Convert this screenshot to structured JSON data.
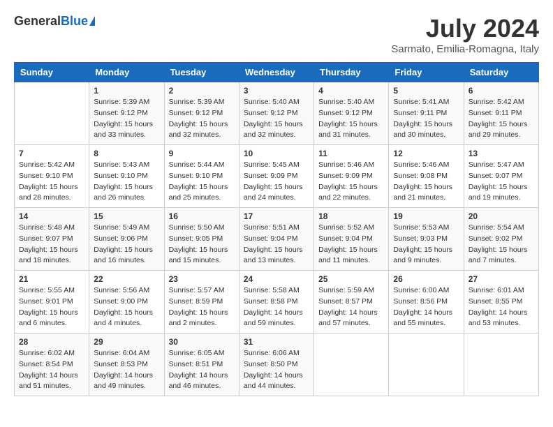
{
  "logo": {
    "general": "General",
    "blue": "Blue"
  },
  "title": "July 2024",
  "subtitle": "Sarmato, Emilia-Romagna, Italy",
  "headers": [
    "Sunday",
    "Monday",
    "Tuesday",
    "Wednesday",
    "Thursday",
    "Friday",
    "Saturday"
  ],
  "weeks": [
    [
      {
        "day": "",
        "sunrise": "",
        "sunset": "",
        "daylight": ""
      },
      {
        "day": "1",
        "sunrise": "Sunrise: 5:39 AM",
        "sunset": "Sunset: 9:12 PM",
        "daylight": "Daylight: 15 hours and 33 minutes."
      },
      {
        "day": "2",
        "sunrise": "Sunrise: 5:39 AM",
        "sunset": "Sunset: 9:12 PM",
        "daylight": "Daylight: 15 hours and 32 minutes."
      },
      {
        "day": "3",
        "sunrise": "Sunrise: 5:40 AM",
        "sunset": "Sunset: 9:12 PM",
        "daylight": "Daylight: 15 hours and 32 minutes."
      },
      {
        "day": "4",
        "sunrise": "Sunrise: 5:40 AM",
        "sunset": "Sunset: 9:12 PM",
        "daylight": "Daylight: 15 hours and 31 minutes."
      },
      {
        "day": "5",
        "sunrise": "Sunrise: 5:41 AM",
        "sunset": "Sunset: 9:11 PM",
        "daylight": "Daylight: 15 hours and 30 minutes."
      },
      {
        "day": "6",
        "sunrise": "Sunrise: 5:42 AM",
        "sunset": "Sunset: 9:11 PM",
        "daylight": "Daylight: 15 hours and 29 minutes."
      }
    ],
    [
      {
        "day": "7",
        "sunrise": "Sunrise: 5:42 AM",
        "sunset": "Sunset: 9:10 PM",
        "daylight": "Daylight: 15 hours and 28 minutes."
      },
      {
        "day": "8",
        "sunrise": "Sunrise: 5:43 AM",
        "sunset": "Sunset: 9:10 PM",
        "daylight": "Daylight: 15 hours and 26 minutes."
      },
      {
        "day": "9",
        "sunrise": "Sunrise: 5:44 AM",
        "sunset": "Sunset: 9:10 PM",
        "daylight": "Daylight: 15 hours and 25 minutes."
      },
      {
        "day": "10",
        "sunrise": "Sunrise: 5:45 AM",
        "sunset": "Sunset: 9:09 PM",
        "daylight": "Daylight: 15 hours and 24 minutes."
      },
      {
        "day": "11",
        "sunrise": "Sunrise: 5:46 AM",
        "sunset": "Sunset: 9:09 PM",
        "daylight": "Daylight: 15 hours and 22 minutes."
      },
      {
        "day": "12",
        "sunrise": "Sunrise: 5:46 AM",
        "sunset": "Sunset: 9:08 PM",
        "daylight": "Daylight: 15 hours and 21 minutes."
      },
      {
        "day": "13",
        "sunrise": "Sunrise: 5:47 AM",
        "sunset": "Sunset: 9:07 PM",
        "daylight": "Daylight: 15 hours and 19 minutes."
      }
    ],
    [
      {
        "day": "14",
        "sunrise": "Sunrise: 5:48 AM",
        "sunset": "Sunset: 9:07 PM",
        "daylight": "Daylight: 15 hours and 18 minutes."
      },
      {
        "day": "15",
        "sunrise": "Sunrise: 5:49 AM",
        "sunset": "Sunset: 9:06 PM",
        "daylight": "Daylight: 15 hours and 16 minutes."
      },
      {
        "day": "16",
        "sunrise": "Sunrise: 5:50 AM",
        "sunset": "Sunset: 9:05 PM",
        "daylight": "Daylight: 15 hours and 15 minutes."
      },
      {
        "day": "17",
        "sunrise": "Sunrise: 5:51 AM",
        "sunset": "Sunset: 9:04 PM",
        "daylight": "Daylight: 15 hours and 13 minutes."
      },
      {
        "day": "18",
        "sunrise": "Sunrise: 5:52 AM",
        "sunset": "Sunset: 9:04 PM",
        "daylight": "Daylight: 15 hours and 11 minutes."
      },
      {
        "day": "19",
        "sunrise": "Sunrise: 5:53 AM",
        "sunset": "Sunset: 9:03 PM",
        "daylight": "Daylight: 15 hours and 9 minutes."
      },
      {
        "day": "20",
        "sunrise": "Sunrise: 5:54 AM",
        "sunset": "Sunset: 9:02 PM",
        "daylight": "Daylight: 15 hours and 7 minutes."
      }
    ],
    [
      {
        "day": "21",
        "sunrise": "Sunrise: 5:55 AM",
        "sunset": "Sunset: 9:01 PM",
        "daylight": "Daylight: 15 hours and 6 minutes."
      },
      {
        "day": "22",
        "sunrise": "Sunrise: 5:56 AM",
        "sunset": "Sunset: 9:00 PM",
        "daylight": "Daylight: 15 hours and 4 minutes."
      },
      {
        "day": "23",
        "sunrise": "Sunrise: 5:57 AM",
        "sunset": "Sunset: 8:59 PM",
        "daylight": "Daylight: 15 hours and 2 minutes."
      },
      {
        "day": "24",
        "sunrise": "Sunrise: 5:58 AM",
        "sunset": "Sunset: 8:58 PM",
        "daylight": "Daylight: 14 hours and 59 minutes."
      },
      {
        "day": "25",
        "sunrise": "Sunrise: 5:59 AM",
        "sunset": "Sunset: 8:57 PM",
        "daylight": "Daylight: 14 hours and 57 minutes."
      },
      {
        "day": "26",
        "sunrise": "Sunrise: 6:00 AM",
        "sunset": "Sunset: 8:56 PM",
        "daylight": "Daylight: 14 hours and 55 minutes."
      },
      {
        "day": "27",
        "sunrise": "Sunrise: 6:01 AM",
        "sunset": "Sunset: 8:55 PM",
        "daylight": "Daylight: 14 hours and 53 minutes."
      }
    ],
    [
      {
        "day": "28",
        "sunrise": "Sunrise: 6:02 AM",
        "sunset": "Sunset: 8:54 PM",
        "daylight": "Daylight: 14 hours and 51 minutes."
      },
      {
        "day": "29",
        "sunrise": "Sunrise: 6:04 AM",
        "sunset": "Sunset: 8:53 PM",
        "daylight": "Daylight: 14 hours and 49 minutes."
      },
      {
        "day": "30",
        "sunrise": "Sunrise: 6:05 AM",
        "sunset": "Sunset: 8:51 PM",
        "daylight": "Daylight: 14 hours and 46 minutes."
      },
      {
        "day": "31",
        "sunrise": "Sunrise: 6:06 AM",
        "sunset": "Sunset: 8:50 PM",
        "daylight": "Daylight: 14 hours and 44 minutes."
      },
      {
        "day": "",
        "sunrise": "",
        "sunset": "",
        "daylight": ""
      },
      {
        "day": "",
        "sunrise": "",
        "sunset": "",
        "daylight": ""
      },
      {
        "day": "",
        "sunrise": "",
        "sunset": "",
        "daylight": ""
      }
    ]
  ]
}
